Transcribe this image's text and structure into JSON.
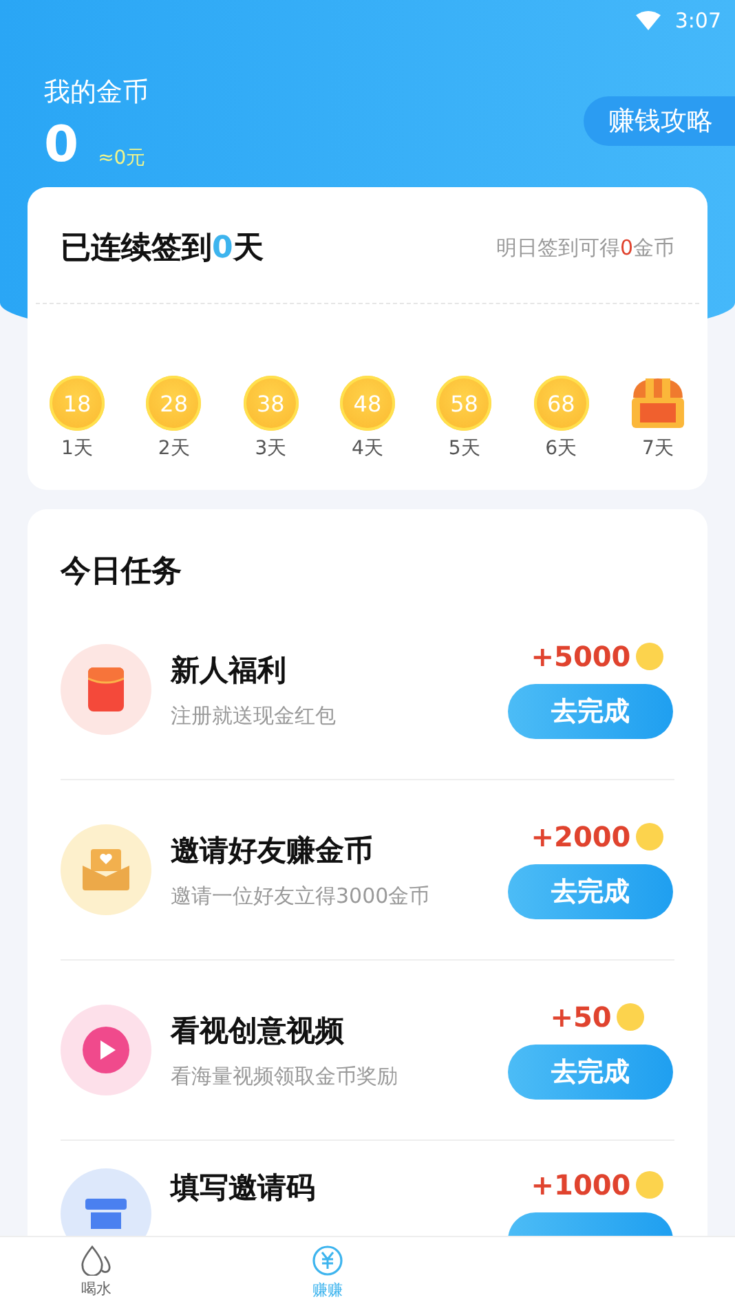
{
  "status_bar": {
    "time": "3:07"
  },
  "header": {
    "title": "我的金币",
    "coins": "0",
    "cash": "≈0元",
    "guide_button": "赚钱攻略"
  },
  "signin": {
    "title_prefix": "已连续签到",
    "days": "0",
    "title_suffix": "天",
    "hint_prefix": "明日签到可得",
    "hint_coins": "0",
    "hint_suffix": "金币",
    "days_list": [
      {
        "kind": "coin",
        "reward": "18",
        "label": "1天"
      },
      {
        "kind": "coin",
        "reward": "28",
        "label": "2天"
      },
      {
        "kind": "coin",
        "reward": "38",
        "label": "3天"
      },
      {
        "kind": "coin",
        "reward": "48",
        "label": "4天"
      },
      {
        "kind": "coin",
        "reward": "58",
        "label": "5天"
      },
      {
        "kind": "coin",
        "reward": "68",
        "label": "6天"
      },
      {
        "kind": "chest",
        "label": "7天"
      }
    ]
  },
  "tasks": {
    "title": "今日任务",
    "items": [
      {
        "kind": "red-packet",
        "title": "新人福利",
        "desc": "注册就送现金红包",
        "reward": "+5000",
        "button": "去完成"
      },
      {
        "kind": "mail",
        "title": "邀请好友赚金币",
        "desc": "邀请一位好友立得3000金币",
        "reward": "+2000",
        "button": "去完成"
      },
      {
        "kind": "video",
        "title": "看视创意视频",
        "desc": "看海量视频领取金币奖励",
        "reward": "+50",
        "button": "去完成"
      },
      {
        "kind": "code",
        "title": "填写邀请码",
        "reward": "+1000"
      }
    ]
  },
  "bottom_nav": [
    {
      "kind": "water",
      "label": "喝水",
      "selected": false
    },
    {
      "kind": "earn",
      "label": "赚赚",
      "selected": true
    }
  ]
}
